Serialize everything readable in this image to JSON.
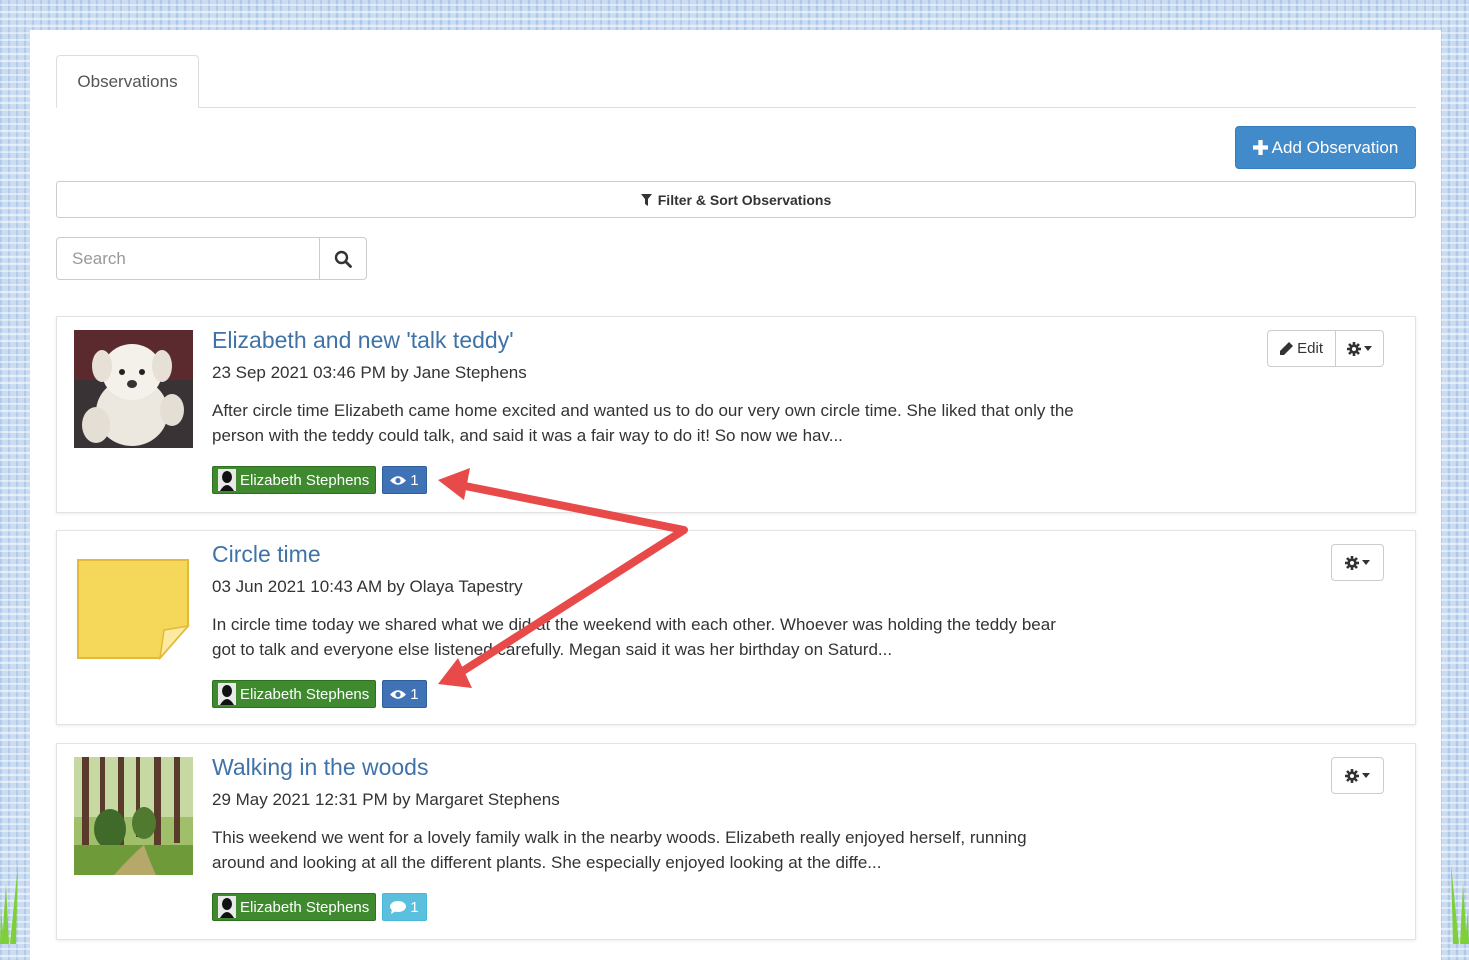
{
  "tabs": [
    {
      "label": "Observations"
    }
  ],
  "toolbar": {
    "add_label": "Add Observation",
    "filter_label": "Filter & Sort Observations"
  },
  "search": {
    "placeholder": "Search"
  },
  "colors": {
    "primary": "#428bca",
    "child_tag": "#3f8a2f",
    "link": "#3f73a8",
    "annotation_arrow": "#e84a4a"
  },
  "observations": [
    {
      "title": "Elizabeth and new 'talk teddy'",
      "meta": "23 Sep 2021 03:46 PM by Jane Stephens",
      "excerpt": "After circle time Elizabeth came home excited and wanted us to do our very own circle time. She liked that only the person with the teddy could talk, and said it was a fair way to do it! So now we hav...",
      "child": "Elizabeth Stephens",
      "count": "1",
      "count_icon": "eye-icon",
      "edit_label": "Edit",
      "thumb": "teddy-photo"
    },
    {
      "title": "Circle time",
      "meta": "03 Jun 2021 10:43 AM by Olaya Tapestry",
      "excerpt": "In circle time today we shared what we did at the weekend with each other. Whoever was holding the teddy bear got to talk and everyone else listened carefully. Megan said it was her birthday on Saturd...",
      "child": "Elizabeth Stephens",
      "count": "1",
      "count_icon": "eye-icon",
      "thumb": "sticky-note"
    },
    {
      "title": "Walking in the woods",
      "meta": "29 May 2021 12:31 PM by Margaret Stephens",
      "excerpt": "This weekend we went for a lovely family walk in the nearby woods. Elizabeth really enjoyed herself, running around and looking at all the different plants. She especially enjoyed looking at the diffe...",
      "child": "Elizabeth Stephens",
      "count": "1",
      "count_icon": "comment-icon",
      "thumb": "woods-photo"
    }
  ]
}
